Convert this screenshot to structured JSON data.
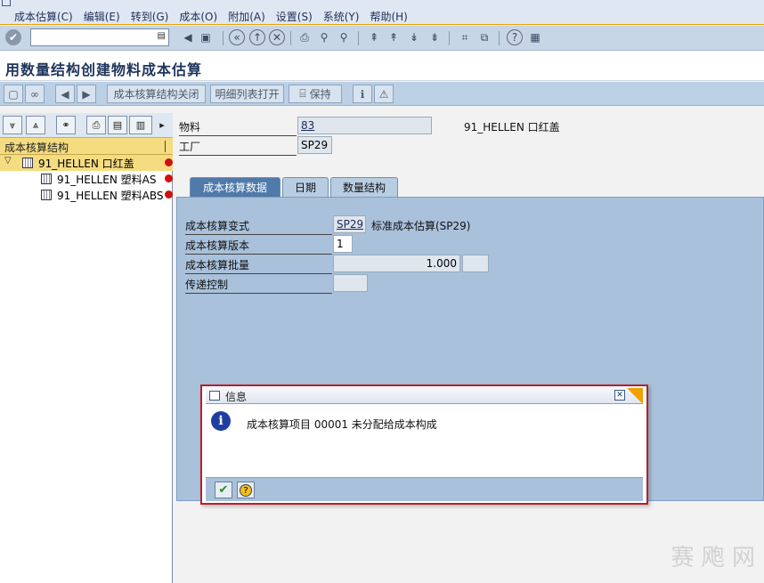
{
  "menubar": {
    "items": [
      "成本估算(C)",
      "编辑(E)",
      "转到(G)",
      "成本(O)",
      "附加(A)",
      "设置(S)",
      "系统(Y)",
      "帮助(H)"
    ]
  },
  "system_toolbar": {
    "command_field_value": "",
    "icons": [
      "enter-icon",
      "save-icon",
      "back-icon",
      "exit-icon",
      "cancel-icon",
      "print-icon",
      "find-icon",
      "find-next-icon",
      "first-page-icon",
      "prev-page-icon",
      "next-page-icon",
      "last-page-icon",
      "new-session-icon",
      "shortcut-icon",
      "help-icon",
      "layout-icon"
    ]
  },
  "title": "用数量结构创建物料成本估算",
  "app_toolbar": {
    "buttons": {
      "costing_structure_close": "成本核算结构关闭",
      "detail_list_open": "明细列表打开",
      "keep": "保持"
    }
  },
  "tree": {
    "header": "成本核算结构",
    "rows": [
      {
        "label": "91_HELLEN 口红盖",
        "level": 0,
        "expanded": true,
        "selected": true
      },
      {
        "label": "91_HELLEN 塑料AS",
        "level": 1
      },
      {
        "label": "91_HELLEN 塑料ABS",
        "level": 1
      }
    ]
  },
  "header_fields": {
    "material_label": "物料",
    "material_value": "83",
    "material_desc": "91_HELLEN 口红盖",
    "plant_label": "工厂",
    "plant_value": "SP29"
  },
  "tabs": [
    {
      "label": "成本核算数据",
      "active": true
    },
    {
      "label": "日期",
      "active": false
    },
    {
      "label": "数量结构",
      "active": false
    }
  ],
  "costing_data": {
    "variant_label": "成本核算变式",
    "variant_value": "SP29",
    "variant_desc": "标准成本估算(SP29)",
    "version_label": "成本核算版本",
    "version_value": "1",
    "lot_label": "成本核算批量",
    "lot_value": "1.000",
    "lot_unit": "",
    "transfer_label": "传递控制",
    "transfer_value": ""
  },
  "dialog": {
    "title": "信息",
    "message": "成本核算项目 00001 未分配给成本构成"
  },
  "watermark": "赛 飑 网",
  "colors": {
    "menubar_bg": "#dfe8f2",
    "accent_orange": "#f0a000",
    "tab_active": "#4f7aaa",
    "dialog_border": "#b8202a",
    "tree_selected": "#f5dc80"
  }
}
